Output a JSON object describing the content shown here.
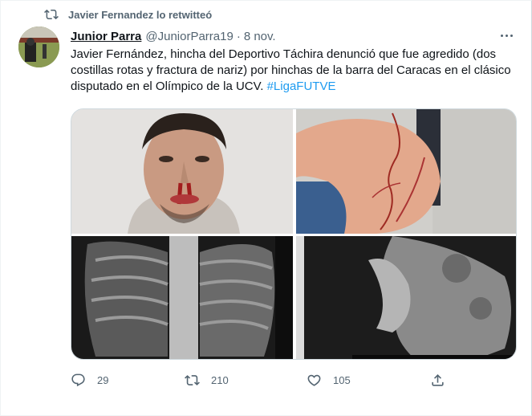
{
  "retweet": {
    "label": "Javier Fernandez lo retwitteó"
  },
  "tweet": {
    "author_name": "Junior Parra",
    "author_handle": "@JuniorParra19",
    "separator": "·",
    "date": "8 nov.",
    "text": "Javier Fernández, hincha del Deportivo Táchira denunció que fue agredido (dos costillas rotas y fractura de nariz) por hinchas de la barra del Caracas en el clásico disputado en el Olímpico de la UCV. ",
    "hashtag": "#LigaFUTVE"
  },
  "media": [
    {
      "icon": "face-photo"
    },
    {
      "icon": "arm-wound-photo"
    },
    {
      "icon": "chest-xray-photo"
    },
    {
      "icon": "nose-xray-photo"
    }
  ],
  "actions": {
    "replies": "29",
    "retweets": "210",
    "likes": "105"
  },
  "colors": {
    "accent": "#1d9bf0",
    "muted": "#536471",
    "text": "#0f1419"
  }
}
